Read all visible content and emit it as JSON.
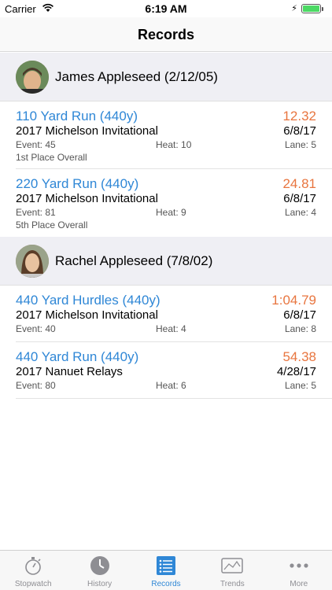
{
  "status": {
    "carrier": "Carrier",
    "time": "6:19 AM"
  },
  "nav": {
    "title": "Records"
  },
  "athletes": [
    {
      "name": "James Appleseed (2/12/05)",
      "records": [
        {
          "event": "110 Yard Run (440y)",
          "mark": "12.32",
          "meet": "2017 Michelson Invitational",
          "date": "6/8/17",
          "event_num": "Event: 45",
          "heat": "Heat: 10",
          "lane": "Lane: 5",
          "place": "1st Place Overall"
        },
        {
          "event": "220 Yard Run (440y)",
          "mark": "24.81",
          "meet": "2017 Michelson Invitational",
          "date": "6/8/17",
          "event_num": "Event: 81",
          "heat": "Heat: 9",
          "lane": "Lane: 4",
          "place": "5th Place Overall"
        }
      ]
    },
    {
      "name": "Rachel Appleseed (7/8/02)",
      "records": [
        {
          "event": "440 Yard Hurdles (440y)",
          "mark": "1:04.79",
          "meet": "2017 Michelson Invitational",
          "date": "6/8/17",
          "event_num": "Event: 40",
          "heat": "Heat: 4",
          "lane": "Lane: 8"
        },
        {
          "event": "440 Yard Run (440y)",
          "mark": "54.38",
          "meet": "2017 Nanuet Relays",
          "date": "4/28/17",
          "event_num": "Event: 80",
          "heat": "Heat: 6",
          "lane": "Lane: 5"
        }
      ]
    }
  ],
  "tabs": [
    {
      "label": "Stopwatch",
      "icon": "stopwatch-icon",
      "active": false
    },
    {
      "label": "History",
      "icon": "clock-icon",
      "active": false
    },
    {
      "label": "Records",
      "icon": "list-icon",
      "active": true
    },
    {
      "label": "Trends",
      "icon": "trend-chart-icon",
      "active": false
    },
    {
      "label": "More",
      "icon": "more-dots-icon",
      "active": false
    }
  ],
  "colors": {
    "accent": "#2f87d6",
    "mark": "#e8753f",
    "battery": "#4cd964"
  }
}
